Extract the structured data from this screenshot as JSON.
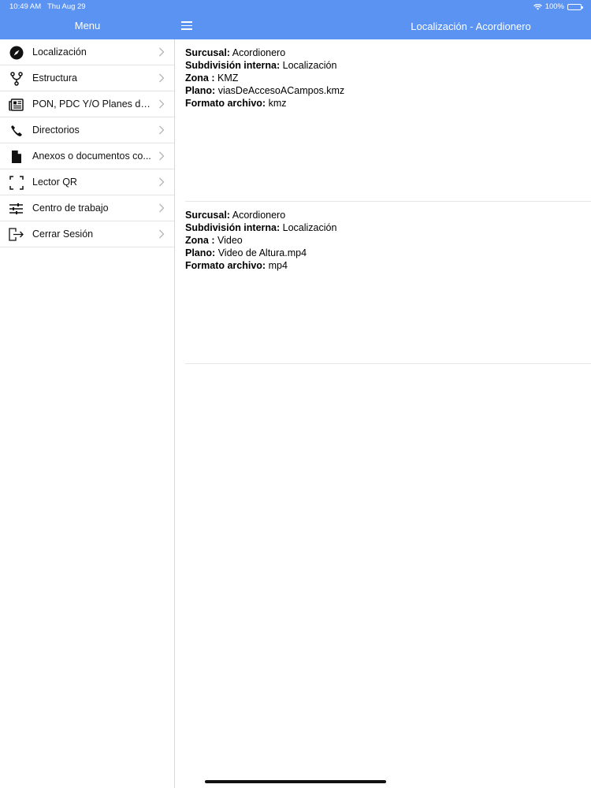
{
  "status": {
    "time": "10:49 AM",
    "date": "Thu Aug 29",
    "battery": "100%"
  },
  "header": {
    "menu_title": "Menu",
    "page_title": "Localización - Acordionero"
  },
  "sidebar": {
    "items": [
      {
        "label": "Localización",
        "icon": "compass-icon"
      },
      {
        "label": "Estructura",
        "icon": "fork-icon"
      },
      {
        "label": "PON, PDC Y/O Planes de...",
        "icon": "newspaper-icon"
      },
      {
        "label": "Directorios",
        "icon": "phone-icon"
      },
      {
        "label": "Anexos o documentos co...",
        "icon": "document-icon"
      },
      {
        "label": "Lector QR",
        "icon": "scan-icon"
      },
      {
        "label": "Centro de trabajo",
        "icon": "sliders-icon"
      },
      {
        "label": "Cerrar Sesión",
        "icon": "logout-icon"
      }
    ]
  },
  "records": [
    {
      "sucursal_label": "Surcusal:",
      "sucursal": "Acordionero",
      "subdivision_label": "Subdivisión interna:",
      "subdivision": "Localización",
      "zona_label": "Zona :",
      "zona": "KMZ",
      "plano_label": "Plano:",
      "plano": "viasDeAccesoACampos.kmz",
      "formato_label": "Formato archivo:",
      "formato": "kmz"
    },
    {
      "sucursal_label": "Surcusal:",
      "sucursal": "Acordionero",
      "subdivision_label": "Subdivisión interna:",
      "subdivision": "Localización",
      "zona_label": "Zona :",
      "zona": "Video",
      "plano_label": "Plano:",
      "plano": "Video de Altura.mp4",
      "formato_label": "Formato archivo:",
      "formato": "mp4"
    }
  ]
}
